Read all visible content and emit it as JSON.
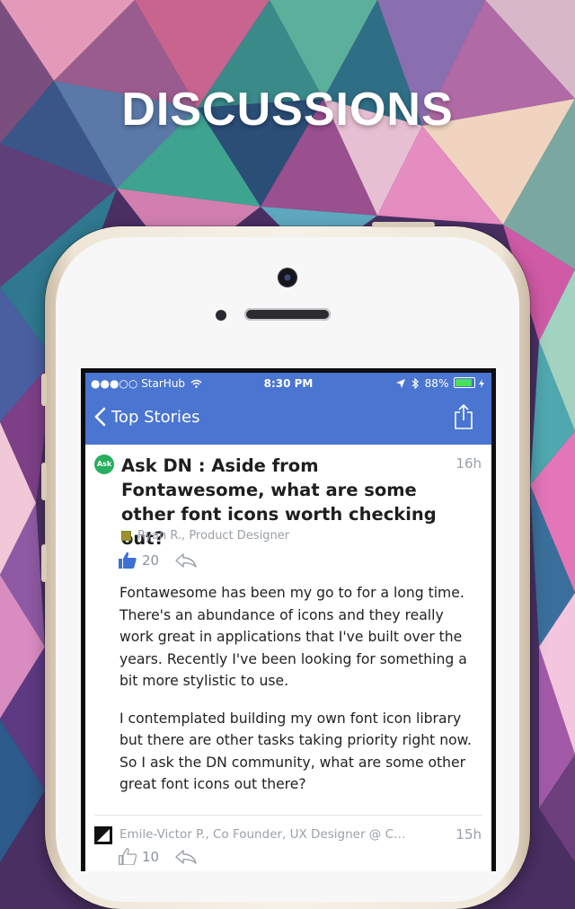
{
  "headline": "DISCUSSIONS",
  "status_bar": {
    "carrier": "StarHub",
    "time": "8:30 PM",
    "battery": "88%",
    "battery_level": 0.88
  },
  "nav": {
    "back_label": "Top Stories",
    "share_icon": "share-icon"
  },
  "post": {
    "badge": "Ask",
    "title": "Ask DN : Aside from Fontawesome, what are some other font icons worth checking out?",
    "time": "16h",
    "author": "Ryan R., Product Designer",
    "upvotes": "20",
    "paragraphs": [
      "Fontawesome has been my go to for a long time. There's an abundance of icons and they really work great in applications that I've built over the years. Recently I've been looking for something a bit more stylistic to use.",
      "I contemplated building my own font icon library but there are other tasks taking priority right now. So I ask the DN community, what are some other great font icons out there?"
    ]
  },
  "comment": {
    "author": "Emile-Victor P., Co Founder, UX Designer @ CoteC...",
    "time": "15h",
    "upvotes": "10"
  },
  "colors": {
    "nav_blue": "#4a75d1",
    "ask_green": "#27ae60",
    "upvote_blue": "#3d6fd6",
    "battery_green": "#46e05a"
  }
}
